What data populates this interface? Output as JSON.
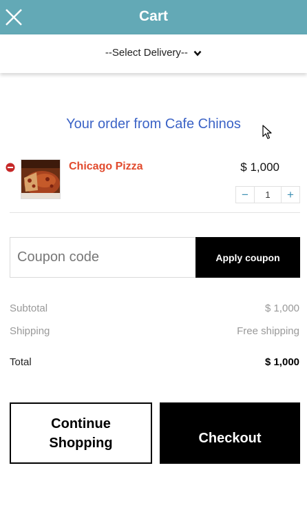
{
  "header": {
    "title": "Cart",
    "close_icon": "close-icon",
    "background_color": "#63a9b6"
  },
  "delivery": {
    "selected": "--Select Delivery--",
    "icon": "chevron-down-icon"
  },
  "order": {
    "title": "Your order from Cafe Chinos"
  },
  "items": [
    {
      "name": "Chicago Pizza",
      "price": "$ 1,000",
      "quantity": "1",
      "remove_icon": "remove-icon",
      "decrement_symbol": "−",
      "increment_symbol": "+"
    }
  ],
  "coupon": {
    "placeholder": "Coupon code",
    "apply_label": "Apply coupon"
  },
  "summary": {
    "subtotal_label": "Subtotal",
    "subtotal_value": "$ 1,000",
    "shipping_label": "Shipping",
    "shipping_value": "Free shipping",
    "total_label": "Total",
    "total_value": "$ 1,000"
  },
  "actions": {
    "continue_label": "Continue Shopping",
    "checkout_label": "Checkout"
  },
  "colors": {
    "accent_blue": "#3b63c6",
    "item_red": "#e14a2d",
    "button_black": "#000000"
  }
}
